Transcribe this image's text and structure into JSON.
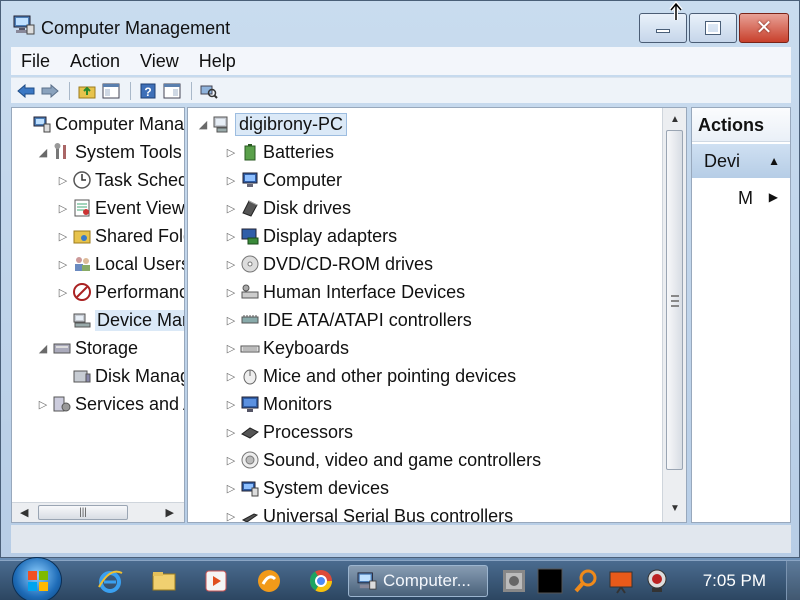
{
  "window": {
    "title": "Computer Management"
  },
  "menu": [
    "File",
    "Action",
    "View",
    "Help"
  ],
  "left_tree": [
    {
      "label": "Computer Manage",
      "indent": 0,
      "twisty": "",
      "icon": "computer-management-icon"
    },
    {
      "label": "System Tools",
      "indent": 1,
      "twisty": "◢",
      "icon": "system-tools-icon"
    },
    {
      "label": "Task Schedule",
      "indent": 2,
      "twisty": "▷",
      "icon": "clock-icon"
    },
    {
      "label": "Event Viewer",
      "indent": 2,
      "twisty": "▷",
      "icon": "event-viewer-icon"
    },
    {
      "label": "Shared Folder",
      "indent": 2,
      "twisty": "▷",
      "icon": "shared-folder-icon"
    },
    {
      "label": "Local Users ar",
      "indent": 2,
      "twisty": "▷",
      "icon": "users-icon"
    },
    {
      "label": "Performance",
      "indent": 2,
      "twisty": "▷",
      "icon": "performance-icon"
    },
    {
      "label": "Device Manag",
      "indent": 2,
      "twisty": "",
      "icon": "device-manager-icon",
      "selected": true
    },
    {
      "label": "Storage",
      "indent": 1,
      "twisty": "◢",
      "icon": "storage-icon"
    },
    {
      "label": "Disk Manager",
      "indent": 2,
      "twisty": "",
      "icon": "disk-management-icon"
    },
    {
      "label": "Services and Ap",
      "indent": 1,
      "twisty": "▷",
      "icon": "services-icon"
    }
  ],
  "device_tree": {
    "root": "digibrony-PC",
    "items": [
      {
        "label": "Batteries",
        "icon": "battery-icon"
      },
      {
        "label": "Computer",
        "icon": "computer-icon"
      },
      {
        "label": "Disk drives",
        "icon": "disk-drive-icon"
      },
      {
        "label": "Display adapters",
        "icon": "display-adapter-icon"
      },
      {
        "label": "DVD/CD-ROM drives",
        "icon": "dvd-drive-icon"
      },
      {
        "label": "Human Interface Devices",
        "icon": "hid-icon"
      },
      {
        "label": "IDE ATA/ATAPI controllers",
        "icon": "ide-controller-icon"
      },
      {
        "label": "Keyboards",
        "icon": "keyboard-icon"
      },
      {
        "label": "Mice and other pointing devices",
        "icon": "mouse-icon"
      },
      {
        "label": "Monitors",
        "icon": "monitor-icon"
      },
      {
        "label": "Processors",
        "icon": "processor-icon"
      },
      {
        "label": "Sound, video and game controllers",
        "icon": "sound-icon"
      },
      {
        "label": "System devices",
        "icon": "system-devices-icon"
      },
      {
        "label": "Universal Serial Bus controllers",
        "icon": "usb-icon"
      }
    ]
  },
  "actions": {
    "header": "Actions",
    "section": "Devi",
    "item": "M"
  },
  "taskbar": {
    "task_label": "Computer...",
    "clock": "7:05 PM"
  },
  "colors": {
    "selection": "#dbe9f7",
    "accent": "#1e6cb8"
  }
}
